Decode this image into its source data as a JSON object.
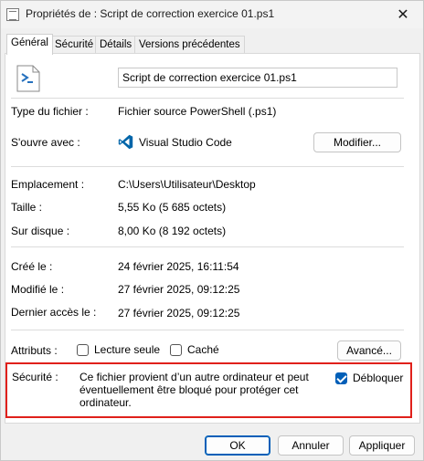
{
  "window": {
    "title": "Propriétés de : Script de correction exercice 01.ps1",
    "close_glyph": "✕"
  },
  "tabs": [
    {
      "label": "Général",
      "active": true
    },
    {
      "label": "Sécurité",
      "active": false
    },
    {
      "label": "Détails",
      "active": false
    },
    {
      "label": "Versions précédentes",
      "active": false
    }
  ],
  "general": {
    "file_name": "Script de correction exercice 01.ps1",
    "file_icon": "powershell-script-icon",
    "type_label": "Type du fichier :",
    "type_value": "Fichier source PowerShell (.ps1)",
    "opens_with_label": "S'ouvre avec :",
    "opens_with_app": "Visual Studio Code",
    "opens_with_icon": "vscode-icon",
    "modify_button": "Modifier...",
    "location_label": "Emplacement :",
    "location_value": "C:\\Users\\Utilisateur\\Desktop",
    "size_label": "Taille :",
    "size_value": "5,55 Ko (5 685 octets)",
    "disk_size_label": "Sur disque :",
    "disk_size_value": "8,00 Ko (8 192 octets)",
    "created_label": "Créé le :",
    "created_value": "24 février 2025, 16:11:54",
    "modified_label": "Modifié le :",
    "modified_value": "27 février 2025, 09:12:25",
    "accessed_label": "Dernier accès le :",
    "accessed_value": "27 février 2025, 09:12:25",
    "attributes_label": "Attributs :",
    "readonly_label": "Lecture seule",
    "readonly_checked": false,
    "hidden_label": "Caché",
    "hidden_checked": false,
    "advanced_button": "Avancé...",
    "security_label": "Sécurité :",
    "security_text": "Ce fichier provient d’un autre ordinateur et peut éventuellement être bloqué pour protéger cet ordinateur.",
    "unblock_label": "Débloquer",
    "unblock_checked": true
  },
  "footer": {
    "ok": "OK",
    "cancel": "Annuler",
    "apply": "Appliquer"
  },
  "colors": {
    "accent": "#005fb8",
    "highlight_border": "#e0201b",
    "powershell": "#2671be",
    "vscode": "#0065a9"
  }
}
